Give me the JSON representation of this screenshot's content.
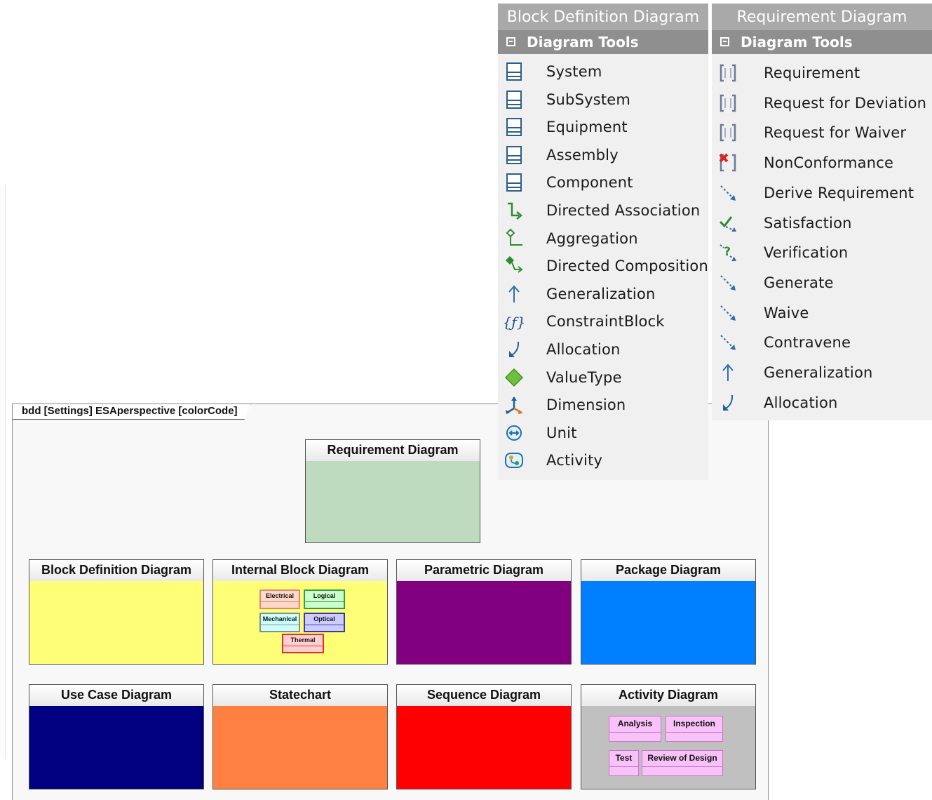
{
  "frame": {
    "title": "bdd [Settings] ESAperspective [colorCode]"
  },
  "blocks": {
    "requirement": {
      "title": "Requirement Diagram",
      "color": "#bfdbbf"
    },
    "block_definition": {
      "title": "Block Definition Diagram",
      "color": "#ffff77"
    },
    "internal_block": {
      "title": "Internal Block Diagram",
      "color": "#ffff77",
      "parts": [
        {
          "name": "Electrical",
          "fill": "#ffd8cc",
          "border": "#e08a70"
        },
        {
          "name": "Logical",
          "fill": "#ccffcc",
          "border": "#2f9f4f"
        },
        {
          "name": "Mechanical",
          "fill": "#ccffff",
          "border": "#8a8a8a"
        },
        {
          "name": "Optical",
          "fill": "#ccccff",
          "border": "#3a3aa0"
        },
        {
          "name": "Thermal",
          "fill": "#ffd0d0",
          "border": "#e03030"
        }
      ]
    },
    "parametric": {
      "title": "Parametric Diagram",
      "color": "#800080"
    },
    "package": {
      "title": "Package Diagram",
      "color": "#0080ff"
    },
    "use_case": {
      "title": "Use Case Diagram",
      "color": "#000080"
    },
    "statechart": {
      "title": "Statechart",
      "color": "#ff8040"
    },
    "sequence": {
      "title": "Sequence Diagram",
      "color": "#ff0000"
    },
    "activity": {
      "title": "Activity Diagram",
      "color": "#c0c0c0",
      "actions": [
        "Analysis",
        "Inspection",
        "Test",
        "Review of Design"
      ]
    }
  },
  "bdd_toolbox": {
    "title": "Block Definition Diagram",
    "section": "Diagram Tools",
    "items": [
      {
        "label": "System",
        "icon": "block-icon"
      },
      {
        "label": "SubSystem",
        "icon": "block-icon"
      },
      {
        "label": "Equipment",
        "icon": "block-icon"
      },
      {
        "label": "Assembly",
        "icon": "block-icon"
      },
      {
        "label": "Component",
        "icon": "block-icon"
      },
      {
        "label": "Directed Association",
        "icon": "directed-association-icon"
      },
      {
        "label": "Aggregation",
        "icon": "aggregation-icon"
      },
      {
        "label": "Directed Composition",
        "icon": "directed-composition-icon"
      },
      {
        "label": "Generalization",
        "icon": "generalization-icon"
      },
      {
        "label": "ConstraintBlock",
        "icon": "constraint-block-icon"
      },
      {
        "label": "Allocation",
        "icon": "allocation-icon"
      },
      {
        "label": "ValueType",
        "icon": "value-type-icon"
      },
      {
        "label": "Dimension",
        "icon": "dimension-icon"
      },
      {
        "label": "Unit",
        "icon": "unit-icon"
      },
      {
        "label": "Activity",
        "icon": "activity-icon"
      }
    ]
  },
  "req_toolbox": {
    "title": "Requirement Diagram",
    "section": "Diagram Tools",
    "items": [
      {
        "label": "Requirement",
        "icon": "requirement-icon"
      },
      {
        "label": "Request for Deviation",
        "icon": "requirement-icon"
      },
      {
        "label": "Request for Waiver",
        "icon": "requirement-icon"
      },
      {
        "label": "NonConformance",
        "icon": "nonconformance-icon"
      },
      {
        "label": "Derive Requirement",
        "icon": "dashed-arrow-icon"
      },
      {
        "label": "Satisfaction",
        "icon": "satisfaction-icon"
      },
      {
        "label": "Verification",
        "icon": "verification-icon"
      },
      {
        "label": "Generate",
        "icon": "dashed-arrow-icon"
      },
      {
        "label": "Waive",
        "icon": "dashed-arrow-icon"
      },
      {
        "label": "Contravene",
        "icon": "dashed-arrow-icon"
      },
      {
        "label": "Generalization",
        "icon": "generalization-icon"
      },
      {
        "label": "Allocation",
        "icon": "allocation-icon"
      }
    ]
  }
}
